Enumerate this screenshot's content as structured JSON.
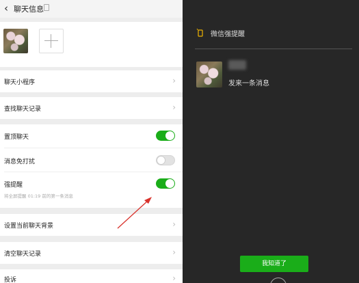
{
  "header": {
    "back_icon": "chevron-left-icon",
    "title": "聊天信息"
  },
  "left": {
    "rows": {
      "mini_program": "聊天小程序",
      "search_history": "查找聊天记录",
      "pin_chat": "置顶聊天",
      "mute": "消息免打扰",
      "strong_remind": "强提醒",
      "strong_remind_sub": "将全屏提醒 01:19 前的第一条消息",
      "set_background": "设置当前聊天背景",
      "clear_history": "清空聊天记录",
      "report": "投诉"
    },
    "toggles": {
      "pin_chat": true,
      "mute": false,
      "strong_remind": true
    }
  },
  "right": {
    "title": "微信强提醒",
    "message": "发来一条消息",
    "button": "我知道了"
  },
  "colors": {
    "accent": "#1aad19",
    "arrow": "#d9322c",
    "dark_bg": "#272727"
  }
}
